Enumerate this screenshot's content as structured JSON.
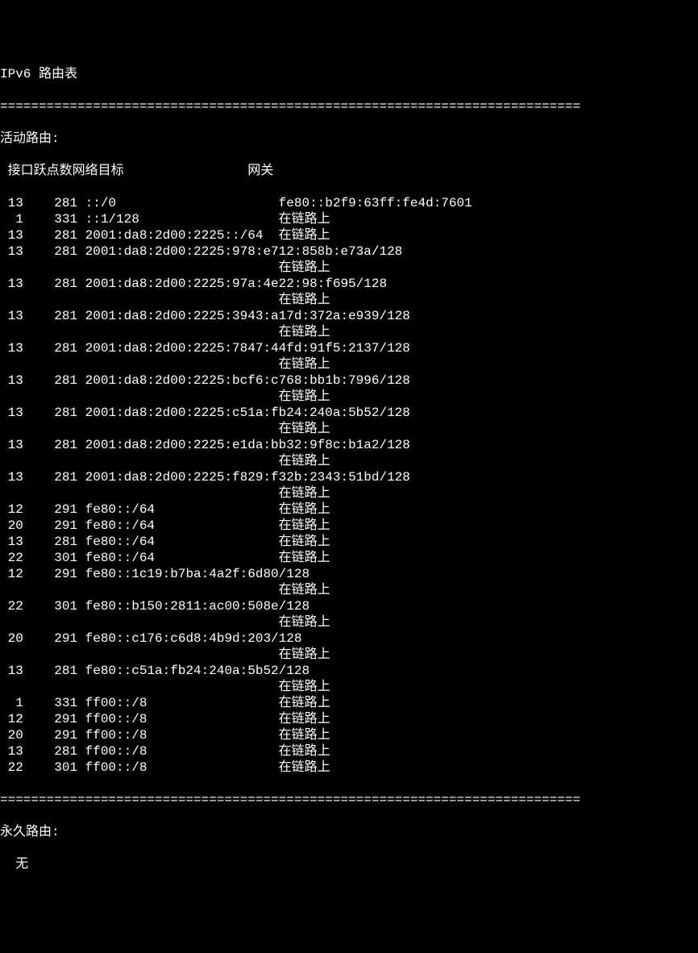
{
  "title": "IPv6 路由表",
  "separator": "===========================================================================",
  "active_routes_header": "活动路由:",
  "column_header_line": " 接口跃点数网络目标                网关",
  "routes": [
    " 13    281 ::/0                     fe80::b2f9:63ff:fe4d:7601",
    "  1    331 ::1/128                  在链路上",
    " 13    281 2001:da8:2d00:2225::/64  在链路上",
    " 13    281 2001:da8:2d00:2225:978:e712:858b:e73a/128",
    "                                    在链路上",
    " 13    281 2001:da8:2d00:2225:97a:4e22:98:f695/128",
    "                                    在链路上",
    " 13    281 2001:da8:2d00:2225:3943:a17d:372a:e939/128",
    "                                    在链路上",
    " 13    281 2001:da8:2d00:2225:7847:44fd:91f5:2137/128",
    "                                    在链路上",
    " 13    281 2001:da8:2d00:2225:bcf6:c768:bb1b:7996/128",
    "                                    在链路上",
    " 13    281 2001:da8:2d00:2225:c51a:fb24:240a:5b52/128",
    "                                    在链路上",
    " 13    281 2001:da8:2d00:2225:e1da:bb32:9f8c:b1a2/128",
    "                                    在链路上",
    " 13    281 2001:da8:2d00:2225:f829:f32b:2343:51bd/128",
    "                                    在链路上",
    " 12    291 fe80::/64                在链路上",
    " 20    291 fe80::/64                在链路上",
    " 13    281 fe80::/64                在链路上",
    " 22    301 fe80::/64                在链路上",
    " 12    291 fe80::1c19:b7ba:4a2f:6d80/128",
    "                                    在链路上",
    " 22    301 fe80::b150:2811:ac00:508e/128",
    "                                    在链路上",
    " 20    291 fe80::c176:c6d8:4b9d:203/128",
    "                                    在链路上",
    " 13    281 fe80::c51a:fb24:240a:5b52/128",
    "                                    在链路上",
    "  1    331 ff00::/8                 在链路上",
    " 12    291 ff00::/8                 在链路上",
    " 20    291 ff00::/8                 在链路上",
    " 13    281 ff00::/8                 在链路上",
    " 22    301 ff00::/8                 在链路上"
  ],
  "persistent_routes_header": "永久路由:",
  "persistent_routes_none": "  无"
}
